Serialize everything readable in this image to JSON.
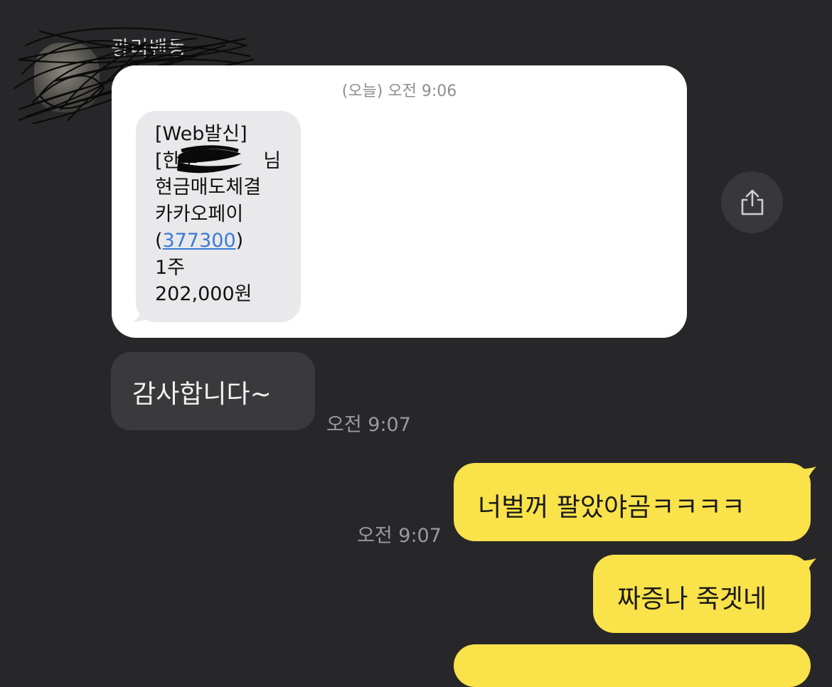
{
  "sender": {
    "name": "광리밴동"
  },
  "sms": {
    "date_label": "(오늘) 오전 9:06",
    "line1": "[Web발신]",
    "line2_prefix": "[한투",
    "line2_suffix": "님",
    "line3": "현금매도체결",
    "line4": "카카오페이",
    "code_open": "(",
    "code": "377300",
    "code_close": ")",
    "line6": "1주",
    "line7": "202,000원"
  },
  "messages": [
    {
      "side": "incoming",
      "text": "감사합니다~",
      "time": "오전 9:07"
    },
    {
      "side": "outgoing",
      "text": "너벌꺼 팔았야곰ㅋㅋㅋㅋ",
      "time": "오전 9:07"
    },
    {
      "side": "outgoing",
      "text": "짜증나 죽겟네"
    }
  ],
  "colors": {
    "background": "#272729",
    "outgoing_bubble": "#f9e24a",
    "incoming_bubble": "#3a3a3c",
    "sms_card": "#ffffff"
  },
  "icons": {
    "share": "share-icon"
  }
}
